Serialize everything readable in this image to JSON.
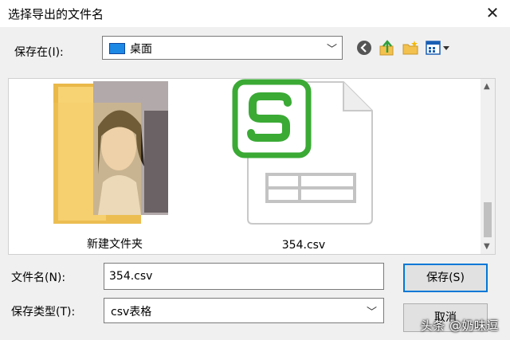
{
  "dialog": {
    "title": "选择导出的文件名"
  },
  "toolbar": {
    "save_in_label": "保存在(I):",
    "location": "桌面",
    "back_icon": "back-arrow-icon",
    "up_icon": "up-folder-icon",
    "new_folder_icon": "new-folder-icon",
    "view_icon": "view-menu-icon"
  },
  "files": [
    {
      "name": "新建文件夹",
      "icon": "folder-icon"
    },
    {
      "name": "354.csv",
      "icon": "csv-file-icon"
    }
  ],
  "form": {
    "filename_label": "文件名(N):",
    "filename_value": "354.csv",
    "filetype_label": "保存类型(T):",
    "filetype_value": "csv表格"
  },
  "buttons": {
    "save": "保存(S)",
    "cancel": "取消"
  },
  "watermark": "头条 @奶味逗",
  "colors": {
    "accent": "#0078d7",
    "csv_green": "#3aaa35",
    "folder_yellow": "#f7d373"
  }
}
